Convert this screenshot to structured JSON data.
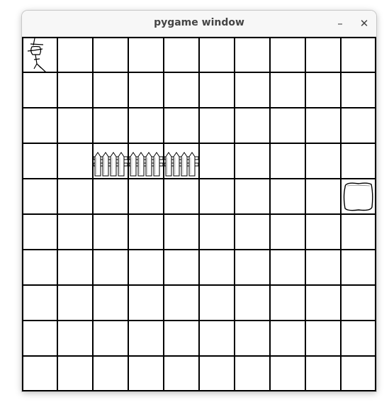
{
  "window": {
    "title": "pygame window",
    "minimize_icon": "minimize-icon",
    "close_icon": "close-icon",
    "minimize_glyph": "–",
    "close_glyph": "✕"
  },
  "board": {
    "rows": 10,
    "cols": 10,
    "background_color": "#ffffff",
    "line_color": "#000000",
    "entities": [
      {
        "name": "player-stick-figure-sprite",
        "kind": "player",
        "row": 0,
        "col": 0
      },
      {
        "name": "fence-sprite",
        "kind": "fence",
        "row": 3,
        "col": 2
      },
      {
        "name": "fence-sprite",
        "kind": "fence",
        "row": 3,
        "col": 3
      },
      {
        "name": "fence-sprite",
        "kind": "fence",
        "row": 3,
        "col": 4
      },
      {
        "name": "goal-square-sprite",
        "kind": "goal",
        "row": 4,
        "col": 9
      }
    ]
  }
}
